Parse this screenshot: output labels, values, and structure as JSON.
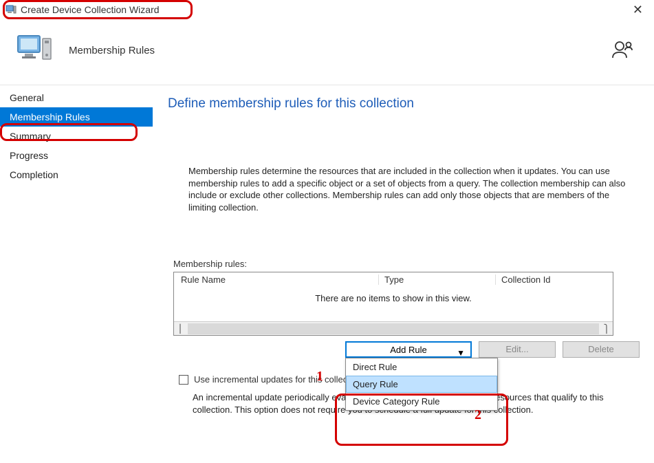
{
  "window": {
    "title": "Create Device Collection Wizard"
  },
  "header": {
    "page_title": "Membership Rules"
  },
  "sidebar": {
    "items": [
      {
        "label": "General"
      },
      {
        "label": "Membership Rules"
      },
      {
        "label": "Summary"
      },
      {
        "label": "Progress"
      },
      {
        "label": "Completion"
      }
    ]
  },
  "main": {
    "heading": "Define membership rules for this collection",
    "description": "Membership rules determine the resources that are included in the collection when it updates. You can use membership rules to add a specific object or a set of objects from a query. The collection membership can also include or exclude other collections. Membership rules can add only those objects that are members of the limiting collection.",
    "rules_label": "Membership rules:",
    "columns": {
      "c1": "Rule Name",
      "c2": "Type",
      "c3": "Collection Id"
    },
    "empty_text": "There are no items to show in this view.",
    "buttons": {
      "add": "Add Rule",
      "edit": "Edit...",
      "delete": "Delete"
    },
    "dropdown": {
      "i0": "Direct Rule",
      "i1": "Query Rule",
      "i2": "Device Category Rule"
    },
    "checkbox_label": "Use incremental updates for this collection",
    "incremental_desc": "An incremental update periodically evaluates new resources and then adds resources that qualify to this collection. This option does not require you to schedule a full update for this collection."
  },
  "annotations": {
    "n1": "1",
    "n2": "2"
  }
}
